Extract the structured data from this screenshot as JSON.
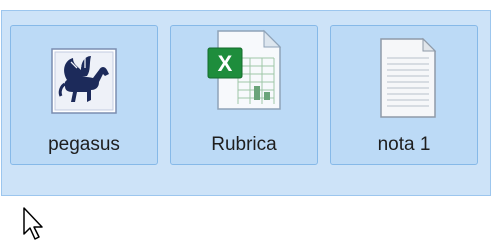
{
  "files": [
    {
      "name": "pegasus",
      "icon": "pegasus-image-icon"
    },
    {
      "name": "Rubrica",
      "icon": "excel-spreadsheet-icon"
    },
    {
      "name": "nota 1",
      "icon": "text-document-icon"
    }
  ],
  "colors": {
    "selection_fill": "#cde3f8",
    "selection_border": "#9cc6ee",
    "item_fill": "#bcdaf6",
    "item_border": "#86b9e8",
    "excel_green": "#1e8d3c",
    "pegasus_navy": "#1c2a5a"
  }
}
